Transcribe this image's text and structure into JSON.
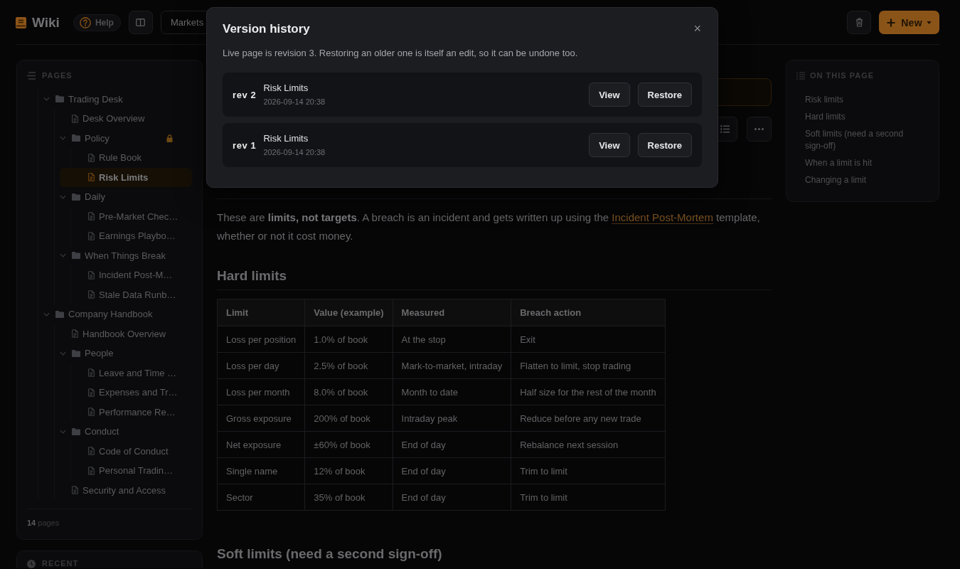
{
  "header": {
    "logo": "Wiki",
    "help": "Help",
    "breadcrumb": "Markets",
    "new_button": "New"
  },
  "sidebar": {
    "title": "PAGES",
    "tree": [
      {
        "label": "Trading Desk",
        "kind": "folder",
        "expanded": true,
        "selected": false,
        "locked": false,
        "children": [
          {
            "label": "Desk Overview",
            "kind": "page",
            "selected": false,
            "locked": false
          },
          {
            "label": "Policy",
            "kind": "folder",
            "expanded": true,
            "selected": false,
            "locked": true,
            "children": [
              {
                "label": "Rule Book",
                "kind": "page",
                "selected": false,
                "locked": false
              },
              {
                "label": "Risk Limits",
                "kind": "page",
                "selected": true,
                "locked": false
              }
            ]
          },
          {
            "label": "Daily",
            "kind": "folder",
            "expanded": true,
            "selected": false,
            "locked": false,
            "children": [
              {
                "label": "Pre-Market Chec…",
                "kind": "page",
                "selected": false,
                "locked": false
              },
              {
                "label": "Earnings Playbo…",
                "kind": "page",
                "selected": false,
                "locked": false
              }
            ]
          },
          {
            "label": "When Things Break",
            "kind": "folder",
            "expanded": true,
            "selected": false,
            "locked": false,
            "children": [
              {
                "label": "Incident Post-M…",
                "kind": "page",
                "selected": false,
                "locked": false
              },
              {
                "label": "Stale Data Runb…",
                "kind": "page",
                "selected": false,
                "locked": false
              }
            ]
          }
        ]
      },
      {
        "label": "Company Handbook",
        "kind": "folder",
        "expanded": true,
        "selected": false,
        "locked": false,
        "children": [
          {
            "label": "Handbook Overview",
            "kind": "page",
            "selected": false,
            "locked": false
          },
          {
            "label": "People",
            "kind": "folder",
            "expanded": true,
            "selected": false,
            "locked": false,
            "children": [
              {
                "label": "Leave and Time …",
                "kind": "page",
                "selected": false,
                "locked": false
              },
              {
                "label": "Expenses and Tr…",
                "kind": "page",
                "selected": false,
                "locked": false
              },
              {
                "label": "Performance Re…",
                "kind": "page",
                "selected": false,
                "locked": false
              }
            ]
          },
          {
            "label": "Conduct",
            "kind": "folder",
            "expanded": true,
            "selected": false,
            "locked": false,
            "children": [
              {
                "label": "Code of Conduct",
                "kind": "page",
                "selected": false,
                "locked": false
              },
              {
                "label": "Personal Tradin…",
                "kind": "page",
                "selected": false,
                "locked": false
              }
            ]
          },
          {
            "label": "Security and Access",
            "kind": "page",
            "selected": false,
            "locked": false
          }
        ]
      }
    ],
    "footer": "**14** pages",
    "recent_title": "RECENT"
  },
  "article": {
    "intro": {
      "before": "These are **limits, not targets**. A breach is an incident and gets written up using the ",
      "link": "Incident Post-Mortem",
      "after": " template, whether or not it cost money."
    },
    "hard_limits": {
      "heading": "Hard limits",
      "table": {
        "columns": [
          "Limit",
          "Value (example)",
          "Measured",
          "Breach action"
        ],
        "rows": [
          [
            "Loss per position",
            "1.0% of book",
            "At the stop",
            "Exit"
          ],
          [
            "Loss per day",
            "2.5% of book",
            "Mark-to-market, intraday",
            "Flatten to limit, stop trading"
          ],
          [
            "Loss per month",
            "8.0% of book",
            "Month to date",
            "Half size for the rest of the month"
          ],
          [
            "Gross exposure",
            "200% of book",
            "Intraday peak",
            "Reduce before any new trade"
          ],
          [
            "Net exposure",
            "±60% of book",
            "End of day",
            "Rebalance next session"
          ],
          [
            "Single name",
            "12% of book",
            "End of day",
            "Trim to limit"
          ],
          [
            "Sector",
            "35% of book",
            "End of day",
            "Trim to limit"
          ]
        ]
      }
    },
    "soft_limits": {
      "heading": "Soft limits (need a second sign-off)"
    }
  },
  "toc": {
    "title": "ON THIS PAGE",
    "items": [
      "Risk limits",
      "Hard limits",
      "Soft limits (need a second sign-off)",
      "When a limit is hit",
      "Changing a limit"
    ]
  },
  "version_history": {
    "title": "Version history",
    "close": "×",
    "description": "Live page is revision 3. Restoring an older one is itself an edit, so it can be undone too.",
    "revisions": [
      {
        "rev": "rev 2",
        "title": "Risk Limits",
        "date": "2026-09-14 20:38",
        "actions": [
          "View",
          "Restore"
        ]
      },
      {
        "rev": "rev 1",
        "title": "Risk Limits",
        "date": "2026-09-14 20:38",
        "actions": [
          "View",
          "Restore"
        ]
      }
    ]
  }
}
